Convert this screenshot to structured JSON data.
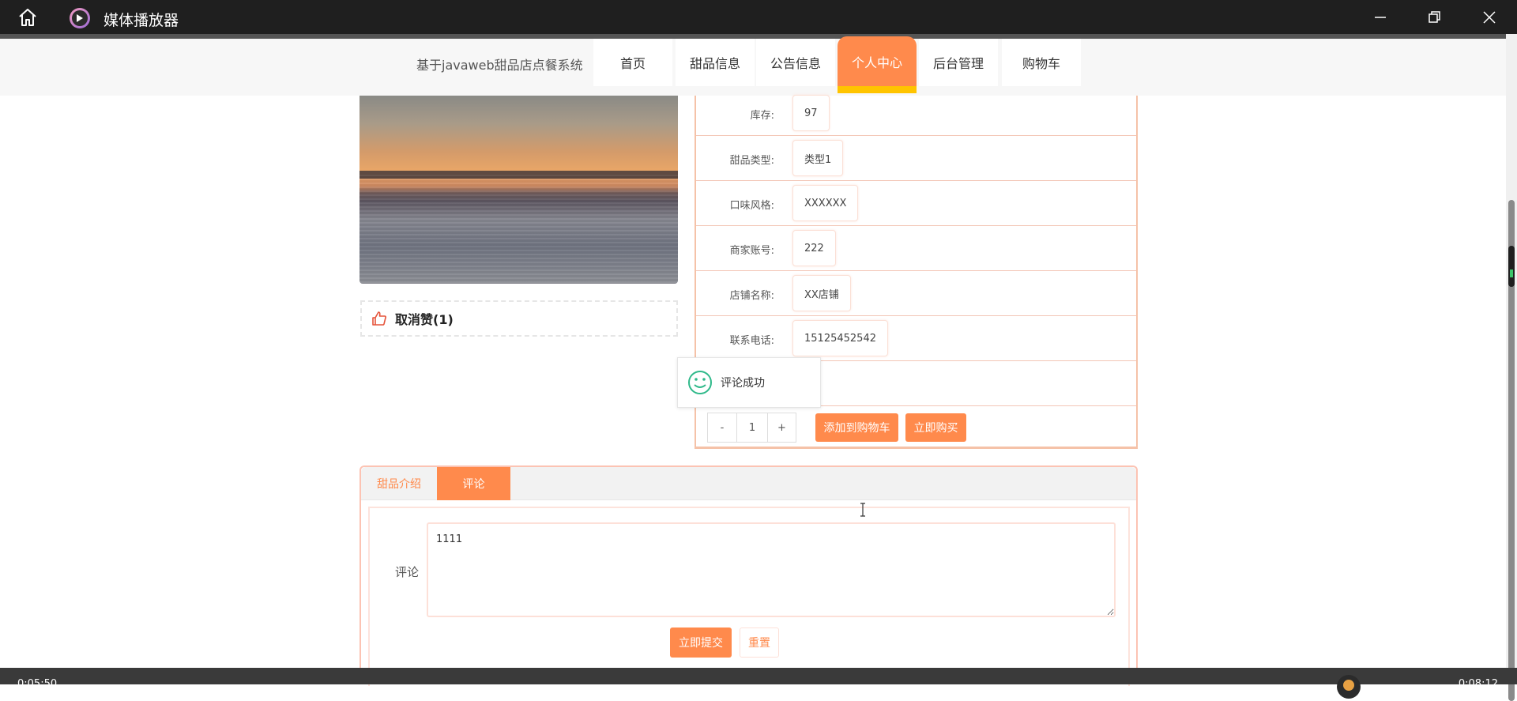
{
  "window": {
    "title": "媒体播放器",
    "controls": [
      "minimize-icon",
      "restore-icon",
      "close-icon"
    ]
  },
  "header": {
    "site_title": "基于javaweb甜品店点餐系统",
    "nav": [
      {
        "label": "首页"
      },
      {
        "label": "甜品信息"
      },
      {
        "label": "公告信息"
      },
      {
        "label": "个人中心",
        "active": true
      },
      {
        "label": "后台管理"
      },
      {
        "label": "购物车"
      }
    ]
  },
  "product": {
    "like_label": "取消赞(1)",
    "fields": [
      {
        "label": "库存:",
        "value": "97"
      },
      {
        "label": "甜品类型:",
        "value": "类型1"
      },
      {
        "label": "口味风格:",
        "value": "XXXXXX"
      },
      {
        "label": "商家账号:",
        "value": "222"
      },
      {
        "label": "店铺名称:",
        "value": "XX店铺"
      },
      {
        "label": "联系电话:",
        "value": "15125452542"
      }
    ],
    "quantity": {
      "minus": "-",
      "value": "1",
      "plus": "+"
    },
    "add_to_cart": "添加到购物车",
    "buy_now": "立即购买"
  },
  "toast": {
    "message": "评论成功"
  },
  "tabs": [
    {
      "label": "甜品介绍",
      "active": false
    },
    {
      "label": "评论",
      "active": true
    }
  ],
  "comment_form": {
    "label": "评论",
    "value": "1111",
    "submit": "立即提交",
    "reset": "重置"
  },
  "colors": {
    "accent": "#ff8a4c",
    "nav_underline": "#ffc400",
    "titlebar": "#1f1f1f",
    "toast_icon": "#2fb98a"
  },
  "player": {
    "elapsed": "0:05:50",
    "total": "0:08:12"
  }
}
